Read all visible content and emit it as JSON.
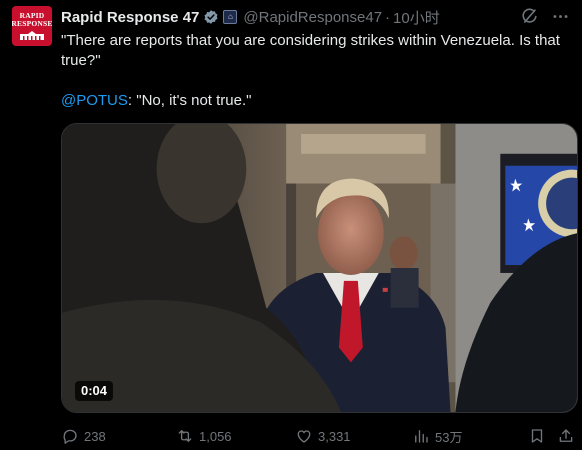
{
  "avatar": {
    "line1": "RAPID",
    "line2": "RESPONSE",
    "icon": "white-house-icon"
  },
  "author": {
    "name": "Rapid Response 47",
    "handle": "@RapidResponse47",
    "separator": "·",
    "time": "10小时",
    "verified_icon": "verified-badge-icon",
    "affiliation_icon": "government-affiliation-icon"
  },
  "header_actions": {
    "grok_icon": "grok-icon",
    "more_icon": "more-icon"
  },
  "tweet": {
    "line1": "\"There are reports that you are considering strikes within Venezuela. Is that true?\"",
    "mention": "@POTUS",
    "reply": ": \"No, it's not true.\""
  },
  "media": {
    "type": "video",
    "timecode": "0:04"
  },
  "actions": {
    "reply": {
      "icon": "reply-icon",
      "count": "238"
    },
    "repost": {
      "icon": "repost-icon",
      "count": "1,056"
    },
    "like": {
      "icon": "like-icon",
      "count": "3,331"
    },
    "views": {
      "icon": "views-icon",
      "count": "53万"
    },
    "bookmark": {
      "icon": "bookmark-icon"
    },
    "share": {
      "icon": "share-icon"
    }
  },
  "colors": {
    "background": "#000000",
    "text": "#e7e9ea",
    "muted": "#71767b",
    "link": "#1d9bf0",
    "avatar": "#c8102e"
  }
}
